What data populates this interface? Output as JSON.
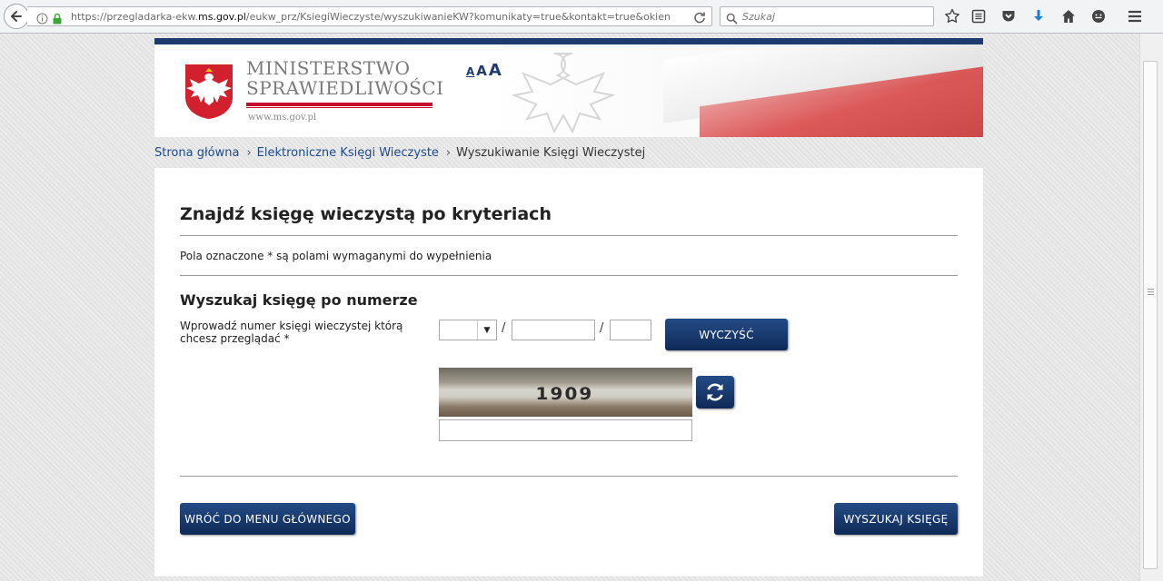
{
  "browser": {
    "url_prefix": "https://przegladarka-ekw.",
    "url_domain": "ms.gov.pl",
    "url_suffix": "/eukw_prz/KsiegiWieczyste/wyszukiwanieKW?komunikaty=true&kontakt=true&okienkoSerwisow",
    "search_placeholder": "Szukaj"
  },
  "header": {
    "ministry_line1": "MINISTERSTWO",
    "ministry_line2": "SPRAWIEDLIWOŚCI",
    "website": "www.ms.gov.pl",
    "font_size_small": "A",
    "font_size_medium": "A",
    "font_size_large": "A"
  },
  "breadcrumb": {
    "home": "Strona główna",
    "section": "Elektroniczne Księgi Wieczyste",
    "current": "Wyszukiwanie Księgi Wieczystej"
  },
  "form": {
    "title": "Znajdź księgę wieczystą po kryteriach",
    "required_note": "Pola oznaczone * są polami wymaganymi do wypełnienia",
    "section_title": "Wyszukaj księgę po numerze",
    "number_label": "Wprowadź numer księgi wieczystej którą chcesz przeglądać *",
    "separator": "/",
    "court_code_value": "",
    "book_number_value": "",
    "check_digit_value": "",
    "clear_button": "WYCZYŚĆ",
    "captcha_text": "1909",
    "captcha_value": "",
    "back_button": "WRÓĆ DO MENU GŁÓWNEGO",
    "search_button": "WYSZUKAJ KSIĘGĘ"
  },
  "colors": {
    "navy": "#1d3b6c",
    "button": "#0f2a57",
    "link": "#1d4a8a",
    "flag_red": "#c8102e"
  }
}
